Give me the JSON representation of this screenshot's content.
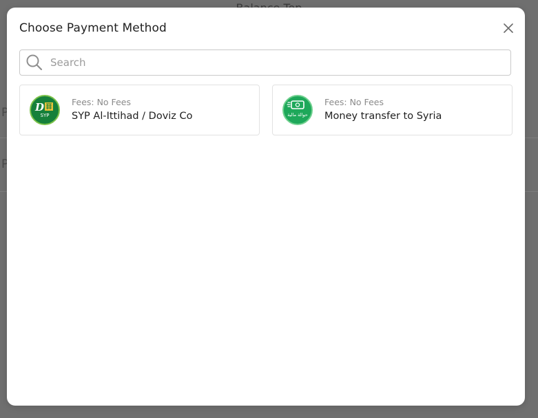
{
  "background": {
    "page_title": "Balance Top",
    "row_letters": [
      "P",
      "P"
    ]
  },
  "modal": {
    "title": "Choose Payment Method",
    "close_icon": "close-icon",
    "search": {
      "placeholder": "Search",
      "value": "",
      "icon": "search-icon"
    },
    "methods": [
      {
        "fees": "Fees: No Fees",
        "name": "SYP Al-Ittihad / Doviz Co",
        "logo_icon": "doviz-logo-icon",
        "logo_text": "SYP"
      },
      {
        "fees": "Fees: No Fees",
        "name": "Money transfer to Syria",
        "logo_icon": "money-transfer-logo-icon",
        "logo_text": "حوالة مالية"
      }
    ]
  },
  "colors": {
    "backdrop": "#6f6f6f",
    "modal_bg": "#ffffff",
    "doviz_green": "#16803a",
    "transfer_green": "#1ea85a"
  }
}
